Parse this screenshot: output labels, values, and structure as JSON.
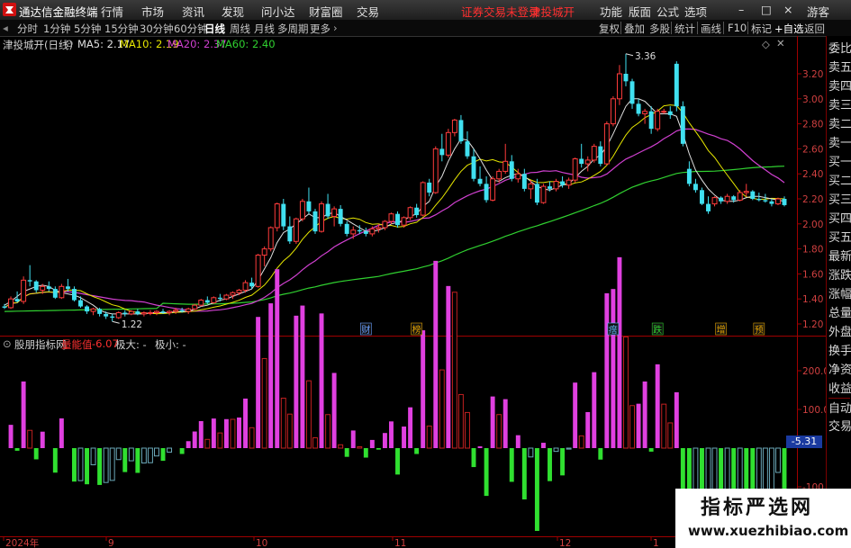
{
  "app": {
    "title": "通达信金融终端",
    "menu": [
      "行情",
      "市场",
      "资讯",
      "发现",
      "问小达",
      "财富圈",
      "交易"
    ],
    "notice": "证券交易未登录",
    "stock_title": "津投城开",
    "right_menu": [
      "功能",
      "版面",
      "公式",
      "选项"
    ],
    "window_buttons": [
      "–",
      "□",
      "×"
    ],
    "guest": "游客"
  },
  "toolbar": {
    "periods": [
      "分时",
      "1分钟",
      "5分钟",
      "15分钟",
      "30分钟",
      "60分钟",
      "日线",
      "周线",
      "月线",
      "多周期",
      "更多"
    ],
    "active_period": "日线",
    "right_buttons": [
      "复权",
      "叠加",
      "多股",
      "统计",
      "画线",
      "F10",
      "标记",
      "+自选",
      "返回"
    ]
  },
  "main_chart": {
    "stock_label": "津投城开(日线)",
    "ma": [
      {
        "label": "MA5: 2.17",
        "color": "#e0e0e0"
      },
      {
        "label": "MA10: 2.19",
        "color": "#e6e600"
      },
      {
        "label": "MA20: 2.37",
        "color": "#d040d0"
      },
      {
        "label": "MA60: 2.40",
        "color": "#30d030"
      }
    ],
    "max_label": "3.36",
    "min_label": "1.22",
    "markers": [
      {
        "text": "财",
        "color": "#6aa0ff"
      },
      {
        "text": "榜",
        "color": "#e0a000"
      },
      {
        "text": "瘔",
        "color": "#60c0ff"
      },
      {
        "text": "跌",
        "color": "#30d030"
      },
      {
        "text": "增",
        "color": "#e0a000"
      },
      {
        "text": "预",
        "color": "#e0a000"
      }
    ],
    "y_ticks": [
      "3.20",
      "3.00",
      "2.80",
      "2.60",
      "2.40",
      "2.20",
      "2.00",
      "1.80",
      "1.60",
      "1.40",
      "1.20"
    ]
  },
  "indicator": {
    "name": "股朋指标网",
    "value_label": "量能值",
    "value": "-6.07",
    "max_label": "极大: -",
    "min_label": "极小: -",
    "y_ticks": [
      "200.0",
      "100.0",
      "-100.0"
    ],
    "current_badge": "-5.31"
  },
  "x_axis": [
    "2024年",
    "9",
    "10",
    "11",
    "12",
    "1"
  ],
  "right_panel": [
    "委比",
    "卖五",
    "卖四",
    "卖三",
    "卖二",
    "卖一",
    "买一",
    "买二",
    "买三",
    "买四",
    "买五",
    "最新",
    "涨跌",
    "涨幅",
    "总量",
    "外盘",
    "换手",
    "净资",
    "收益",
    "自动",
    "交易"
  ],
  "watermark": {
    "line1": "指标严选网",
    "line2": "www.xuezhibiao.com"
  },
  "chart_data": {
    "type": "candlestick",
    "ylim": [
      1.13,
      3.5
    ],
    "candles": [
      [
        1.34,
        1.36,
        1.32,
        1.33
      ],
      [
        1.33,
        1.42,
        1.32,
        1.4
      ],
      [
        1.4,
        1.46,
        1.37,
        1.38
      ],
      [
        1.38,
        1.58,
        1.36,
        1.55
      ],
      [
        1.55,
        1.67,
        1.5,
        1.54
      ],
      [
        1.54,
        1.55,
        1.45,
        1.47
      ],
      [
        1.47,
        1.52,
        1.44,
        1.5
      ],
      [
        1.5,
        1.54,
        1.46,
        1.48
      ],
      [
        1.48,
        1.5,
        1.4,
        1.41
      ],
      [
        1.41,
        1.52,
        1.4,
        1.5
      ],
      [
        1.5,
        1.56,
        1.46,
        1.48
      ],
      [
        1.48,
        1.5,
        1.38,
        1.39
      ],
      [
        1.39,
        1.42,
        1.33,
        1.34
      ],
      [
        1.34,
        1.35,
        1.28,
        1.3
      ],
      [
        1.3,
        1.33,
        1.27,
        1.32
      ],
      [
        1.32,
        1.33,
        1.26,
        1.28
      ],
      [
        1.28,
        1.3,
        1.24,
        1.26
      ],
      [
        1.26,
        1.28,
        1.22,
        1.25
      ],
      [
        1.25,
        1.3,
        1.24,
        1.29
      ],
      [
        1.29,
        1.31,
        1.26,
        1.28
      ],
      [
        1.28,
        1.31,
        1.27,
        1.3
      ],
      [
        1.3,
        1.32,
        1.27,
        1.28
      ],
      [
        1.28,
        1.3,
        1.26,
        1.29
      ],
      [
        1.29,
        1.31,
        1.27,
        1.29
      ],
      [
        1.29,
        1.31,
        1.27,
        1.3
      ],
      [
        1.3,
        1.32,
        1.28,
        1.29
      ],
      [
        1.29,
        1.31,
        1.27,
        1.3
      ],
      [
        1.3,
        1.33,
        1.28,
        1.31
      ],
      [
        1.31,
        1.33,
        1.29,
        1.3
      ],
      [
        1.3,
        1.33,
        1.28,
        1.32
      ],
      [
        1.32,
        1.36,
        1.31,
        1.35
      ],
      [
        1.35,
        1.4,
        1.34,
        1.39
      ],
      [
        1.39,
        1.42,
        1.36,
        1.37
      ],
      [
        1.37,
        1.42,
        1.36,
        1.41
      ],
      [
        1.41,
        1.44,
        1.38,
        1.4
      ],
      [
        1.4,
        1.44,
        1.39,
        1.43
      ],
      [
        1.43,
        1.46,
        1.4,
        1.45
      ],
      [
        1.45,
        1.48,
        1.43,
        1.47
      ],
      [
        1.47,
        1.55,
        1.45,
        1.53
      ],
      [
        1.53,
        1.57,
        1.48,
        1.5
      ],
      [
        1.5,
        1.76,
        1.49,
        1.75
      ],
      [
        1.75,
        1.82,
        1.66,
        1.8
      ],
      [
        1.8,
        1.98,
        1.78,
        1.97
      ],
      [
        1.97,
        2.17,
        1.94,
        2.16
      ],
      [
        2.16,
        2.2,
        1.95,
        1.98
      ],
      [
        1.98,
        2.06,
        1.84,
        1.86
      ],
      [
        1.86,
        2.05,
        1.84,
        2.04
      ],
      [
        2.04,
        2.2,
        2.02,
        2.18
      ],
      [
        2.18,
        2.29,
        2.08,
        2.1
      ],
      [
        2.1,
        2.12,
        1.92,
        1.94
      ],
      [
        1.94,
        2.18,
        1.93,
        2.16
      ],
      [
        2.16,
        2.24,
        2.04,
        2.06
      ],
      [
        2.06,
        2.14,
        1.98,
        2.12
      ],
      [
        2.12,
        2.15,
        1.98,
        2.0
      ],
      [
        2.0,
        2.02,
        1.9,
        1.92
      ],
      [
        1.92,
        1.98,
        1.88,
        1.95
      ],
      [
        1.95,
        1.99,
        1.92,
        1.94
      ],
      [
        1.94,
        1.97,
        1.9,
        1.92
      ],
      [
        1.92,
        1.98,
        1.9,
        1.96
      ],
      [
        1.96,
        2.0,
        1.93,
        1.97
      ],
      [
        1.97,
        2.03,
        1.95,
        2.02
      ],
      [
        2.02,
        2.09,
        2.0,
        2.08
      ],
      [
        2.08,
        2.1,
        1.97,
        1.99
      ],
      [
        1.99,
        2.06,
        1.97,
        2.05
      ],
      [
        2.05,
        2.14,
        2.03,
        2.13
      ],
      [
        2.13,
        2.16,
        2.05,
        2.07
      ],
      [
        2.07,
        2.34,
        2.06,
        2.33
      ],
      [
        2.33,
        2.36,
        2.22,
        2.25
      ],
      [
        2.25,
        2.62,
        2.24,
        2.6
      ],
      [
        2.6,
        2.72,
        2.5,
        2.55
      ],
      [
        2.55,
        2.76,
        2.53,
        2.73
      ],
      [
        2.73,
        2.84,
        2.7,
        2.83
      ],
      [
        2.83,
        2.87,
        2.64,
        2.66
      ],
      [
        2.66,
        2.74,
        2.52,
        2.54
      ],
      [
        2.54,
        2.6,
        2.34,
        2.36
      ],
      [
        2.36,
        2.46,
        2.3,
        2.32
      ],
      [
        2.32,
        2.38,
        2.17,
        2.19
      ],
      [
        2.19,
        2.38,
        2.18,
        2.36
      ],
      [
        2.36,
        2.44,
        2.33,
        2.42
      ],
      [
        2.42,
        2.64,
        2.4,
        2.5
      ],
      [
        2.5,
        2.55,
        2.34,
        2.36
      ],
      [
        2.36,
        2.44,
        2.33,
        2.4
      ],
      [
        2.4,
        2.44,
        2.26,
        2.28
      ],
      [
        2.28,
        2.35,
        2.2,
        2.32
      ],
      [
        2.32,
        2.36,
        2.15,
        2.17
      ],
      [
        2.17,
        2.32,
        2.16,
        2.3
      ],
      [
        2.3,
        2.34,
        2.26,
        2.28
      ],
      [
        2.28,
        2.36,
        2.26,
        2.34
      ],
      [
        2.34,
        2.38,
        2.29,
        2.31
      ],
      [
        2.31,
        2.37,
        2.28,
        2.35
      ],
      [
        2.35,
        2.53,
        2.33,
        2.52
      ],
      [
        2.52,
        2.64,
        2.45,
        2.48
      ],
      [
        2.48,
        2.54,
        2.42,
        2.51
      ],
      [
        2.51,
        2.64,
        2.49,
        2.62
      ],
      [
        2.62,
        2.66,
        2.46,
        2.48
      ],
      [
        2.48,
        2.82,
        2.47,
        2.8
      ],
      [
        2.8,
        3.02,
        2.78,
        3.0
      ],
      [
        3.0,
        3.27,
        2.95,
        3.2
      ],
      [
        3.2,
        3.36,
        3.1,
        3.14
      ],
      [
        3.14,
        3.16,
        2.92,
        2.96
      ],
      [
        2.96,
        3.0,
        2.86,
        2.88
      ],
      [
        2.88,
        2.92,
        2.8,
        2.9
      ],
      [
        2.9,
        2.94,
        2.72,
        2.76
      ],
      [
        2.76,
        2.92,
        2.74,
        2.9
      ],
      [
        2.9,
        2.92,
        2.88,
        2.9
      ],
      [
        2.9,
        2.94,
        2.84,
        2.87
      ],
      [
        3.28,
        3.3,
        2.9,
        2.94
      ],
      [
        2.94,
        2.98,
        2.62,
        2.64
      ],
      [
        2.44,
        2.5,
        2.3,
        2.32
      ],
      [
        2.32,
        2.36,
        2.25,
        2.27
      ],
      [
        2.27,
        2.29,
        2.15,
        2.16
      ],
      [
        2.16,
        2.22,
        2.08,
        2.1
      ],
      [
        2.16,
        2.22,
        2.14,
        2.21
      ],
      [
        2.21,
        2.22,
        2.16,
        2.18
      ],
      [
        2.18,
        2.24,
        2.16,
        2.22
      ],
      [
        2.22,
        2.23,
        2.17,
        2.19
      ],
      [
        2.19,
        2.27,
        2.18,
        2.25
      ],
      [
        2.25,
        2.32,
        2.22,
        2.26
      ],
      [
        2.26,
        2.27,
        2.19,
        2.2
      ],
      [
        2.2,
        2.25,
        2.18,
        2.19
      ],
      [
        2.19,
        2.24,
        2.17,
        2.18
      ],
      [
        2.18,
        2.2,
        2.14,
        2.16
      ],
      [
        2.16,
        2.21,
        2.15,
        2.2
      ],
      [
        2.2,
        2.22,
        2.14,
        2.15
      ]
    ],
    "ma5": [
      1.35,
      1.38,
      1.42,
      1.46,
      1.48,
      1.5,
      1.51,
      1.5,
      1.47,
      1.45,
      1.44,
      1.43,
      1.41,
      1.38,
      1.35,
      1.31,
      1.29,
      1.28,
      1.28,
      1.28,
      1.28,
      1.28,
      1.28,
      1.29,
      1.29,
      1.29,
      1.29,
      1.3,
      1.3,
      1.3,
      1.32,
      1.34,
      1.35,
      1.37,
      1.39,
      1.4,
      1.42,
      1.44,
      1.46,
      1.48,
      1.55,
      1.64,
      1.73,
      1.85,
      1.93,
      1.96,
      2.0,
      2.04,
      2.08,
      2.05,
      2.05,
      2.08,
      2.09,
      2.06,
      2.03,
      2.0,
      1.97,
      1.94,
      1.94,
      1.95,
      1.97,
      2.0,
      2.01,
      2.03,
      2.06,
      2.08,
      2.14,
      2.18,
      2.3,
      2.38,
      2.5,
      2.6,
      2.68,
      2.67,
      2.6,
      2.52,
      2.43,
      2.35,
      2.34,
      2.37,
      2.39,
      2.4,
      2.38,
      2.34,
      2.3,
      2.28,
      2.27,
      2.29,
      2.31,
      2.32,
      2.37,
      2.42,
      2.46,
      2.52,
      2.55,
      2.62,
      2.72,
      2.83,
      2.94,
      3.0,
      3.0,
      2.98,
      2.93,
      2.88,
      2.88,
      2.88,
      2.86,
      2.72,
      2.56,
      2.43,
      2.35,
      2.28,
      2.23,
      2.19,
      2.18,
      2.18,
      2.19,
      2.21,
      2.22,
      2.22,
      2.21,
      2.2,
      2.19,
      2.18
    ]
  }
}
